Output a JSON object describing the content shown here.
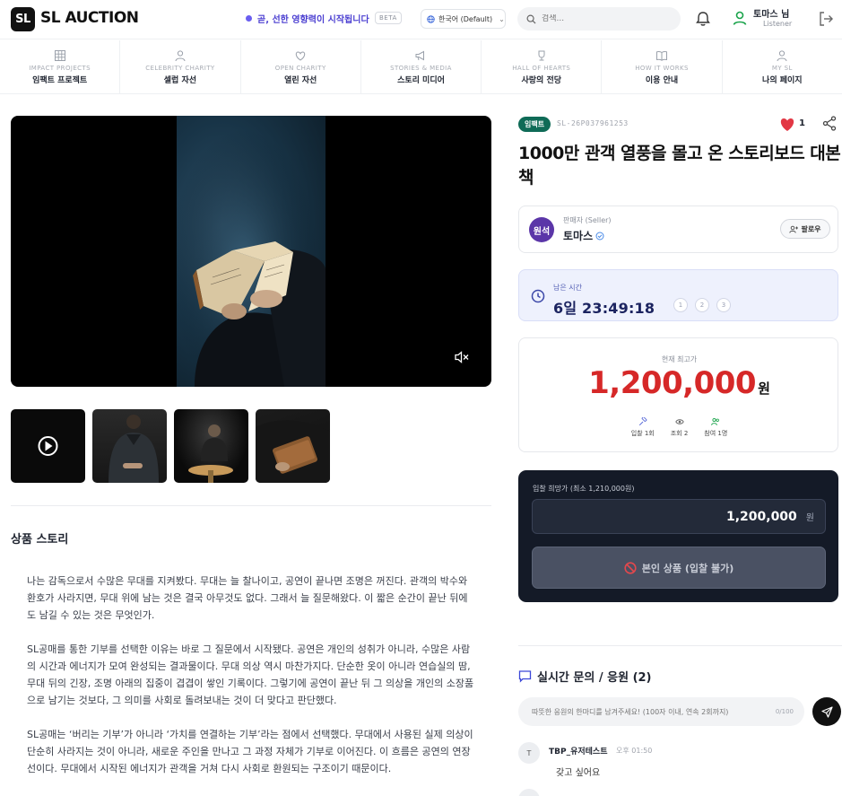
{
  "header": {
    "logo_badge": "SL",
    "logo_text": "SL AUCTION",
    "tagline": "곧, 선한 영향력이 시작됩니다",
    "beta": "BETA",
    "language": "한국어 (Default)",
    "search_placeholder": "검색...",
    "user_name": "토마스 님",
    "user_role": "Listener"
  },
  "nav": [
    {
      "en": "IMPACT PROJECTS",
      "ko": "임팩트 프로젝트",
      "icon": "grid-icon"
    },
    {
      "en": "CELEBRITY CHARITY",
      "ko": "셀럽 자선",
      "icon": "person-icon"
    },
    {
      "en": "OPEN CHARITY",
      "ko": "열린 자선",
      "icon": "heart-icon"
    },
    {
      "en": "STORIES & MEDIA",
      "ko": "스토리 미디어",
      "icon": "megaphone-icon"
    },
    {
      "en": "HALL OF HEARTS",
      "ko": "사랑의 전당",
      "icon": "trophy-icon"
    },
    {
      "en": "HOW IT WORKS",
      "ko": "이용 안내",
      "icon": "book-icon"
    },
    {
      "en": "MY SL",
      "ko": "나의 페이지",
      "icon": "person-icon"
    }
  ],
  "item": {
    "badge": "임팩트",
    "code": "SL-26P037961253",
    "likes": "1",
    "title": "1000만 관객 열풍을 몰고 온 스토리보드 대본책"
  },
  "seller": {
    "avatar_text": "원석",
    "label": "판매자 (Seller)",
    "name": "토마스",
    "follow_label": "팔로우"
  },
  "timer": {
    "label": "남은 시간",
    "value": "6일 23:49:18",
    "steps": [
      "1",
      "2",
      "3"
    ]
  },
  "bid": {
    "label": "현재 최고가",
    "amount": "1,200,000",
    "unit": "원",
    "stats": {
      "bids": "입찰 1회",
      "views": "조회 2",
      "participants": "참여 1명"
    }
  },
  "bid_panel": {
    "label": "입찰 희망가 (최소 1,210,000원)",
    "value": "1,200,000",
    "unit": "원",
    "button": "본인 상품 (입찰 불가)"
  },
  "story": {
    "title": "상품 스토리",
    "paragraphs": [
      "나는 감독으로서 수많은 무대를 지켜봤다. 무대는 늘 찰나이고, 공연이 끝나면 조명은 꺼진다. 관객의 박수와 환호가 사라지면, 무대 위에 남는 것은 결국 아무것도 없다. 그래서 늘 질문해왔다. 이 짧은 순간이 끝난 뒤에도 남길 수 있는 것은 무엇인가.",
      "SL공매를 통한 기부를 선택한 이유는 바로 그 질문에서 시작됐다. 공연은 개인의 성취가 아니라, 수많은 사람의 시간과 에너지가 모여 완성되는 결과물이다. 무대 의상 역시 마찬가지다. 단순한 옷이 아니라 연습실의 땀, 무대 뒤의 긴장, 조명 아래의 집중이 겹겹이 쌓인 기록이다. 그렇기에 공연이 끝난 뒤 그 의상을 개인의 소장품으로 남기는 것보다, 그 의미를 사회로 돌려보내는 것이 더 맞다고 판단했다.",
      "SL공매는 ‘버리는 기부’가 아니라 ‘가치를 연결하는 기부’라는 점에서 선택했다. 무대에서 사용된 실제 의상이 단순히 사라지는 것이 아니라, 새로운 주인을 만나고 그 과정 자체가 기부로 이어진다. 이 흐름은 공연의 연장선이다. 무대에서 시작된 에너지가 관객을 거쳐 다시 사회로 환원되는 구조이기 때문이다."
    ]
  },
  "qa": {
    "title": "실시간 문의 / 응원 (2)",
    "placeholder": "따뜻한 응원의 한마디를 남겨주세요! (100자 이내, 연속 2회까지)",
    "count": "0/100",
    "comments": [
      {
        "avatar": "T",
        "author": "TBP_유저테스트",
        "time": "오후 01:50",
        "text": "갖고 싶어요"
      }
    ]
  },
  "colors": {
    "accent": "#4b3fd1",
    "price": "#d62828",
    "badge_green": "#0f6b57",
    "panel_dark": "#141a27"
  }
}
